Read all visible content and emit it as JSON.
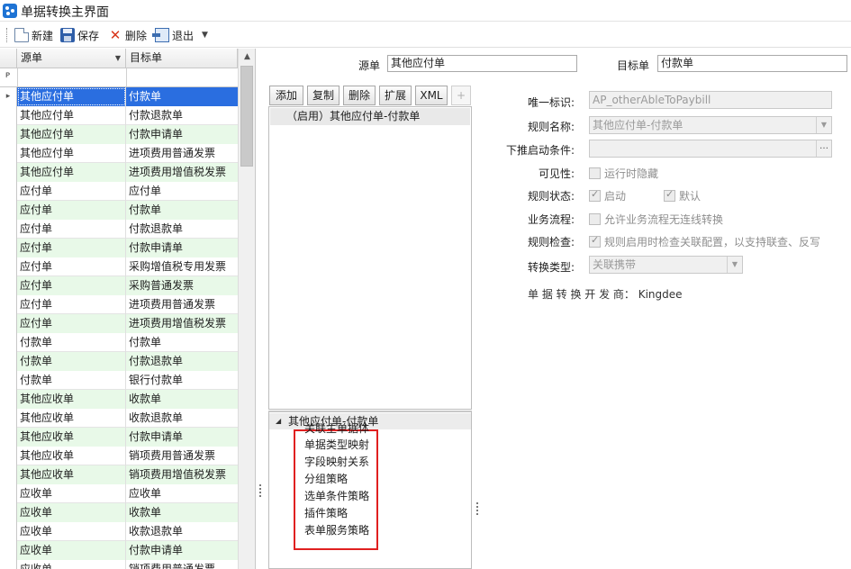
{
  "window": {
    "title": "单据转换主界面"
  },
  "toolbar": {
    "new": "新建",
    "save": "保存",
    "delete": "删除",
    "exit": "退出"
  },
  "grid": {
    "col_source": "源单",
    "col_target": "目标单",
    "rows": [
      {
        "source": "其他应付单",
        "target": "付款单"
      },
      {
        "source": "其他应付单",
        "target": "付款退款单"
      },
      {
        "source": "其他应付单",
        "target": "付款申请单"
      },
      {
        "source": "其他应付单",
        "target": "进项费用普通发票"
      },
      {
        "source": "其他应付单",
        "target": "进项费用增值税发票"
      },
      {
        "source": "应付单",
        "target": "应付单"
      },
      {
        "source": "应付单",
        "target": "付款单"
      },
      {
        "source": "应付单",
        "target": "付款退款单"
      },
      {
        "source": "应付单",
        "target": "付款申请单"
      },
      {
        "source": "应付单",
        "target": "采购增值税专用发票"
      },
      {
        "source": "应付单",
        "target": "采购普通发票"
      },
      {
        "source": "应付单",
        "target": "进项费用普通发票"
      },
      {
        "source": "应付单",
        "target": "进项费用增值税发票"
      },
      {
        "source": "付款单",
        "target": "付款单"
      },
      {
        "source": "付款单",
        "target": "付款退款单"
      },
      {
        "source": "付款单",
        "target": "银行付款单"
      },
      {
        "source": "其他应收单",
        "target": "收款单"
      },
      {
        "source": "其他应收单",
        "target": "收款退款单"
      },
      {
        "source": "其他应收单",
        "target": "付款申请单"
      },
      {
        "source": "其他应收单",
        "target": "销项费用普通发票"
      },
      {
        "source": "其他应收单",
        "target": "销项费用增值税发票"
      },
      {
        "source": "应收单",
        "target": "应收单"
      },
      {
        "source": "应收单",
        "target": "收款单"
      },
      {
        "source": "应收单",
        "target": "收款退款单"
      },
      {
        "source": "应收单",
        "target": "付款申请单"
      },
      {
        "source": "应收单",
        "target": "销项费用普通发票"
      }
    ]
  },
  "header": {
    "source_label": "源单",
    "source_value": "其他应付单",
    "target_label": "目标单",
    "target_value": "付款单"
  },
  "rule_toolbar": {
    "add": "添加",
    "copy": "复制",
    "delete": "删除",
    "extend": "扩展",
    "xml": "XML",
    "plus": "+"
  },
  "rule_list": [
    "（启用）其他应付单-付款单"
  ],
  "tree": {
    "root": "其他应付单-付款单",
    "children": [
      "关联主单据体",
      "单据类型映射",
      "字段映射关系",
      "分组策略",
      "选单条件策略",
      "插件策略",
      "表单服务策略"
    ]
  },
  "form": {
    "id_label": "唯一标识:",
    "id_value": "AP_otherAbleToPaybill",
    "name_label": "规则名称:",
    "name_value": "其他应付单-付款单",
    "push_label": "下推启动条件:",
    "push_value": "",
    "visibility_label": "可见性:",
    "visibility_option": "运行时隐藏",
    "status_label": "规则状态:",
    "status_enable": "启动",
    "status_default": "默认",
    "flow_label": "业务流程:",
    "flow_option": "允许业务流程无连线转换",
    "check_label": "规则检查:",
    "check_option": "规则启用时检查关联配置，以支持联查、反写",
    "type_label": "转换类型:",
    "type_value": "关联携带",
    "developer": "单 据 转 换 开 发 商： Kingdee"
  }
}
